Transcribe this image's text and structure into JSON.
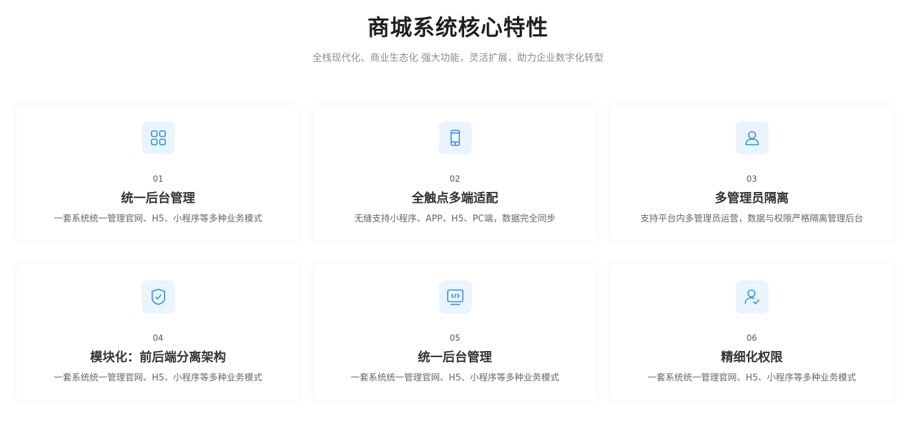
{
  "header": {
    "title": "商城系统核心特性",
    "subtitle": "全栈现代化、商业生态化 强大功能，灵活扩展，助力企业数字化转型"
  },
  "theme": {
    "accent": "#2f8fe8",
    "icon_bg": "#eaf4fe"
  },
  "features": [
    {
      "icon": "grid-icon",
      "num": "01",
      "title": "统一后台管理",
      "desc": "一套系统统一管理官网、H5、小程序等多种业务模式"
    },
    {
      "icon": "phone-icon",
      "num": "02",
      "title": "全触点多端适配",
      "desc": "无缝支持小程序、APP、H5、PC端，数据完全同步"
    },
    {
      "icon": "user-icon",
      "num": "03",
      "title": "多管理员隔离",
      "desc": "支持平台内多管理员运营，数据与权限严格隔离管理后台"
    },
    {
      "icon": "shield-check-icon",
      "num": "04",
      "title": "模块化：前后端分离架构",
      "desc": "一套系统统一管理官网、H5、小程序等多种业务模式"
    },
    {
      "icon": "code-monitor-icon",
      "num": "05",
      "title": "统一后台管理",
      "desc": "一套系统统一管理官网、H5、小程序等多种业务模式"
    },
    {
      "icon": "user-check-icon",
      "num": "06",
      "title": "精细化权限",
      "desc": "一套系统统一管理官网、H5、小程序等多种业务模式"
    }
  ]
}
